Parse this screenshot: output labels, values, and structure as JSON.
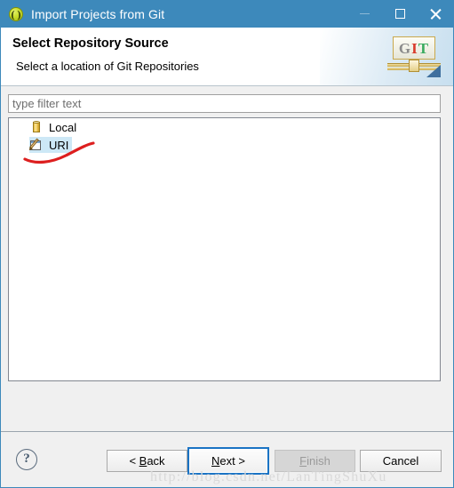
{
  "window": {
    "title": "Import Projects from Git",
    "icon": "eclipse-git-icon",
    "controls": {
      "minimize": "minimize-icon",
      "maximize": "maximize-icon",
      "close": "close-icon"
    }
  },
  "header": {
    "title": "Select Repository Source",
    "subtitle": "Select a location of Git Repositories",
    "logo": {
      "g": "G",
      "i": "I",
      "t": "T"
    }
  },
  "content": {
    "filter": {
      "value": "",
      "placeholder": "type filter text"
    },
    "tree": {
      "items": [
        {
          "label": "Local",
          "icon": "database-icon",
          "selected": false
        },
        {
          "label": "URI",
          "icon": "uri-page-pencil-icon",
          "selected": true
        }
      ]
    },
    "annotation": {
      "type": "red-underline-curve",
      "color": "#dd1f1f"
    }
  },
  "footer": {
    "help": "?",
    "buttons": {
      "back": {
        "pre": "< ",
        "mnemonic": "B",
        "post": "ack",
        "enabled": true,
        "focused": false
      },
      "next": {
        "pre": "",
        "mnemonic": "N",
        "post": "ext >",
        "enabled": true,
        "focused": true
      },
      "finish": {
        "pre": "",
        "mnemonic": "F",
        "post": "inish",
        "enabled": false,
        "focused": false
      },
      "cancel": {
        "pre": "",
        "mnemonic": "",
        "post": "Cancel",
        "enabled": true,
        "focused": false
      }
    }
  },
  "watermark": {
    "text": "http://blog.csdn.net/LanTingShuXu"
  },
  "colors": {
    "titlebar": "#3d89bb",
    "selection": "#cde8f6",
    "focus_ring": "#1a73c4",
    "annotation_red": "#dd1f1f"
  }
}
